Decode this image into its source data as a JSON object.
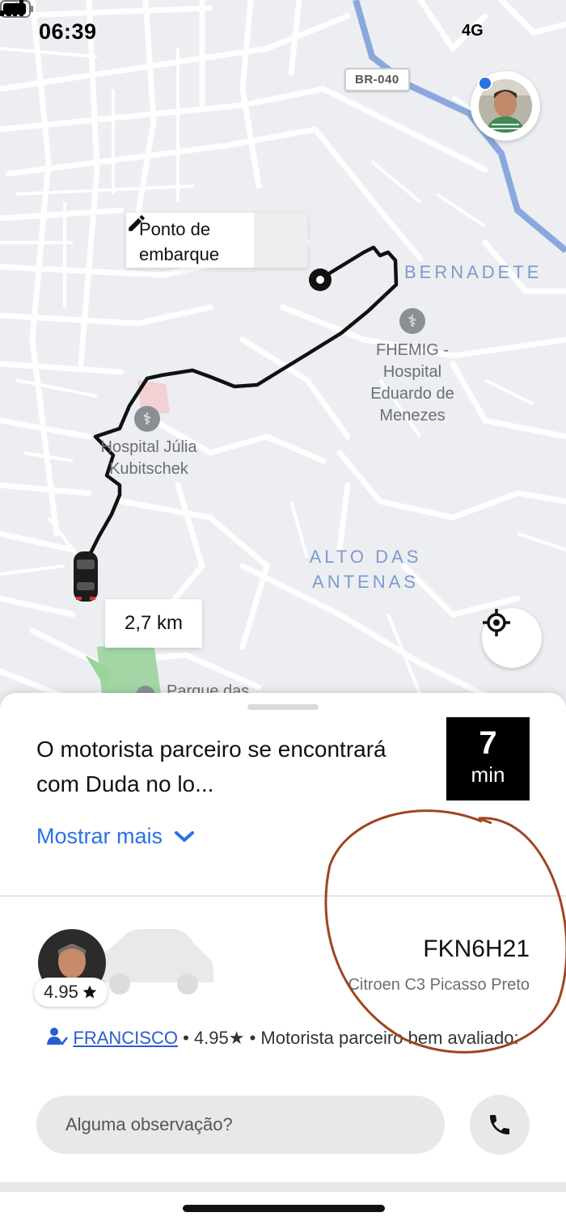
{
  "status_bar": {
    "time": "06:39",
    "network": "4G"
  },
  "map": {
    "road_badge": "BR-040",
    "pickup_label": "Ponto de\nembarque",
    "labels": {
      "bernadete": "BERNADETE",
      "fhemig": "FHEMIG -\nHospital\nEduardo de\nMenezes",
      "hospital_julia": "Hospital Júlia\nKubitschek",
      "alto_das_antenas": "ALTO DAS\nANTENAS",
      "parque": "Parque das"
    },
    "distance": "2,7 km"
  },
  "trip": {
    "message": "O motorista parceiro se encontrará com Duda no lo...",
    "eta_value": "7",
    "eta_unit": "min",
    "show_more": "Mostrar mais"
  },
  "driver": {
    "rating_chip": "4.95",
    "plate": "FKN6H21",
    "car_model": "Citroen C3 Picasso Preto",
    "name": "FRANCISCO",
    "rating_text": "4.95★",
    "description": "Motorista parceiro bem avaliado:"
  },
  "note": {
    "placeholder": "Alguma observação?"
  },
  "colors": {
    "accent": "#2a72e5",
    "route": "#111111",
    "annotation": "#a0441e",
    "highway": "#8aa8de"
  }
}
